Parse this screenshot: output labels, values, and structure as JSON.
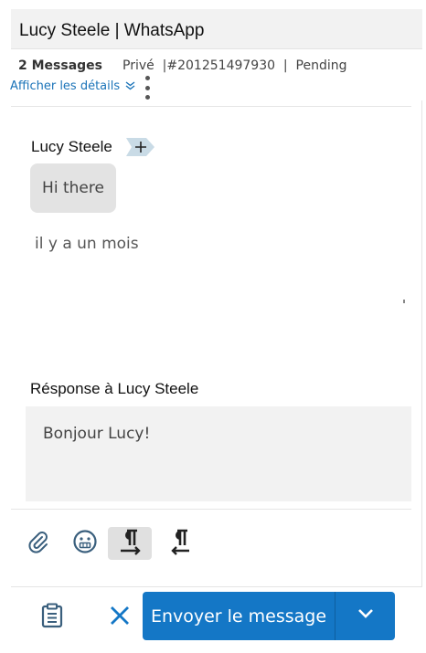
{
  "header": {
    "title": "Lucy Steele | WhatsApp"
  },
  "meta": {
    "message_count": "2 Messages",
    "visibility": "Privé",
    "ticket": "|#201251497930",
    "separator": "|",
    "status": "Pending",
    "details_link": "Afficher les détails",
    "details_icon": "double-chevron-down-icon",
    "more_icon": "kebab-menu-icon"
  },
  "conversation": {
    "sender": "Lucy Steele",
    "add_icon": "plus-tag-icon",
    "message": "Hi there",
    "time_ago": "il y a un mois"
  },
  "reply": {
    "label": "Résponse à Lucy Steele",
    "value": "Bonjour Lucy!"
  },
  "toolbar": {
    "icons": [
      "paperclip-icon",
      "emoji-icon",
      "ltr-paragraph-icon",
      "rtl-paragraph-icon"
    ],
    "active": "ltr-paragraph-icon"
  },
  "actions": {
    "notes_icon": "clipboard-icon",
    "cancel_icon": "close-icon",
    "send_label": "Envoyer le message",
    "send_dropdown_icon": "chevron-down-icon"
  },
  "colors": {
    "accent": "#1477c6",
    "link": "#1a73b8",
    "tag": "#c9dbe6"
  }
}
